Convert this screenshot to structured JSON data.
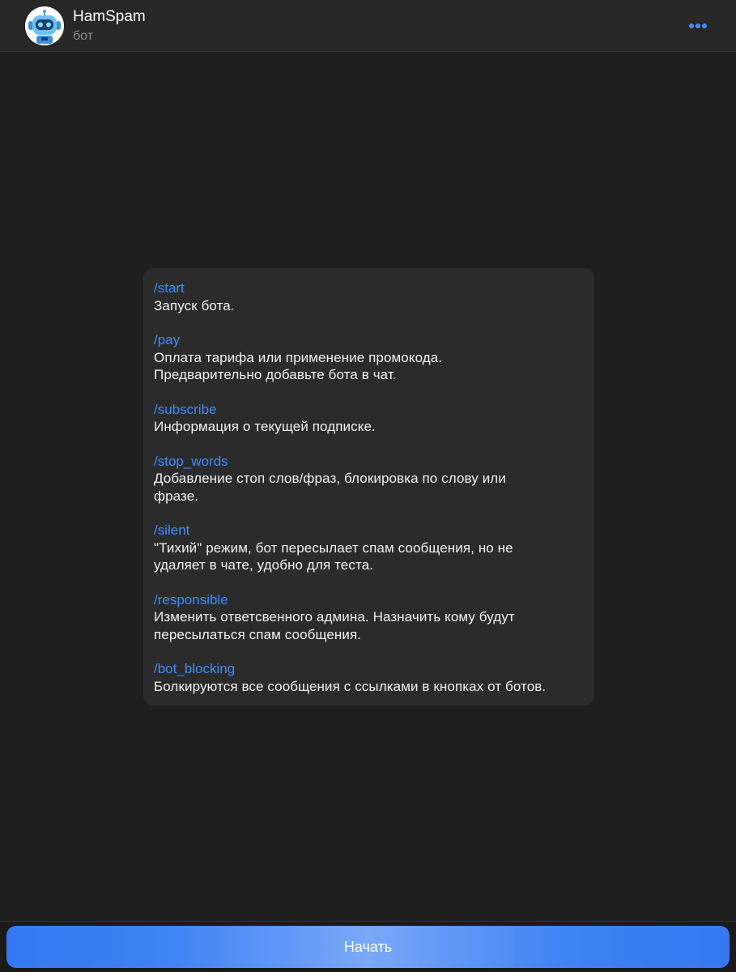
{
  "header": {
    "title": "HamSpam",
    "subtitle": "бот",
    "avatar_icon": "robot-avatar-icon",
    "more_icon": "more-dots-icon"
  },
  "message": {
    "commands": [
      {
        "command": "/start",
        "description": [
          "Запуск бота."
        ]
      },
      {
        "command": "/pay",
        "description": [
          "Оплата тарифа или применение промокода.",
          "Предварительно добавьте бота в чат."
        ]
      },
      {
        "command": "/subscribe",
        "description": [
          "Информация о текущей подписке."
        ]
      },
      {
        "command": "/stop_words",
        "description": [
          "Добавление стоп слов/фраз, блокировка по слову или",
          "фразе."
        ]
      },
      {
        "command": "/silent",
        "description": [
          "\"Тихий\" режим, бот пересылает спам сообщения, но не",
          "удаляет в чате, удобно для теста."
        ]
      },
      {
        "command": "/responsible",
        "description": [
          "Изменить ответсвенного админа. Назначить кому будут",
          "пересылаться спам сообщения."
        ]
      },
      {
        "command": "/bot_blocking",
        "description": [
          "Болкируются все сообщения с ссылками в кнопках от ботов."
        ]
      }
    ]
  },
  "bottom": {
    "start_label": "Начать"
  },
  "colors": {
    "background": "#1f1f1f",
    "header": "#272727",
    "bubble": "#2b2b2b",
    "link": "#3f8cff",
    "button": "#3578f1"
  }
}
